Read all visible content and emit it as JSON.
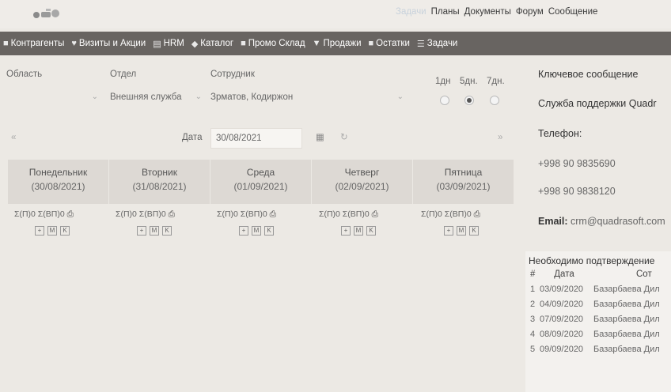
{
  "topnav": [
    "Планы",
    "Документы",
    "Форум",
    "Сообщение"
  ],
  "topnav_muted": "Задачи",
  "navbar": [
    {
      "icon": "users-icon",
      "label": "Контрагенты"
    },
    {
      "icon": "pin-icon",
      "label": "Визиты и Акции"
    },
    {
      "icon": "hrm-icon",
      "label": "HRM"
    },
    {
      "icon": "tag-icon",
      "label": "Каталог"
    },
    {
      "icon": "box-icon",
      "label": "Промо Склад"
    },
    {
      "icon": "cart-icon",
      "label": "Продажи"
    },
    {
      "icon": "stock-icon",
      "label": "Остатки"
    },
    {
      "icon": "list-icon",
      "label": "Задачи"
    }
  ],
  "filters": {
    "region_label": "Область",
    "region_value": "",
    "dept_label": "Отдел",
    "dept_value": "Внешняя служба",
    "employee_label": "Сотрудник",
    "employee_value": "Зрматов, Кодиржон"
  },
  "period": {
    "options": [
      "1дн",
      "5дн.",
      "7дн."
    ],
    "selected": "5дн."
  },
  "date": {
    "label": "Дата",
    "value": "30/08/2021"
  },
  "days": [
    {
      "name": "Понедельник",
      "date": "(30/08/2021)",
      "sum1": "Σ(П)0",
      "sum2": "Σ(ВП)0"
    },
    {
      "name": "Вторник",
      "date": "(31/08/2021)",
      "sum1": "Σ(П)0",
      "sum2": "Σ(ВП)0"
    },
    {
      "name": "Среда",
      "date": "(01/09/2021)",
      "sum1": "Σ(П)0",
      "sum2": "Σ(ВП)0"
    },
    {
      "name": "Четверг",
      "date": "(02/09/2021)",
      "sum1": "Σ(П)0",
      "sum2": "Σ(ВП)0"
    },
    {
      "name": "Пятница",
      "date": "(03/09/2021)",
      "sum1": "Σ(П)0",
      "sum2": "Σ(ВП)0"
    }
  ],
  "day_buttons": [
    "+",
    "M",
    "K"
  ],
  "sidebar": {
    "key_title": "Ключевое сообщение",
    "support": "Служба поддержки Quadr",
    "phone_label": "Телефон:",
    "phone1": "+998 90 9835690",
    "phone2": "+998 90 9838120",
    "email_label": "Email:",
    "email_value": "crm@quadrasoft.com"
  },
  "confirm": {
    "title": "Необходимо подтверждение",
    "columns": [
      "#",
      "Дата",
      "Сот"
    ],
    "rows": [
      {
        "n": "1",
        "date": "03/09/2020",
        "name": "Базарбаева Дил"
      },
      {
        "n": "2",
        "date": "04/09/2020",
        "name": "Базарбаева Дил"
      },
      {
        "n": "3",
        "date": "07/09/2020",
        "name": "Базарбаева Дил"
      },
      {
        "n": "4",
        "date": "08/09/2020",
        "name": "Базарбаева Дил"
      },
      {
        "n": "5",
        "date": "09/09/2020",
        "name": "Базарбаева Дил"
      }
    ]
  }
}
